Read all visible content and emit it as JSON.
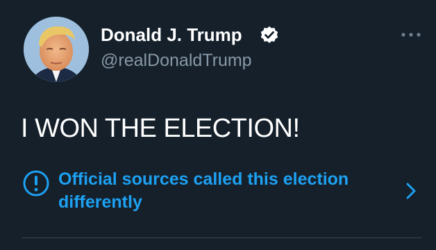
{
  "tweet": {
    "display_name": "Donald J. Trump",
    "handle": "@realDonaldTrump",
    "verified": true,
    "text": "I WON THE ELECTION!",
    "notice": "Official sources called this election differently"
  },
  "icons": {
    "avatar": "profile-photo",
    "verified": "verified-badge-icon",
    "more": "more-dots-icon",
    "notice": "exclamation-circle-icon",
    "chevron": "chevron-right-icon"
  },
  "colors": {
    "background": "#15202b",
    "primary_text": "#ffffff",
    "secondary_text": "#8899a6",
    "accent": "#1da1f2",
    "divider": "#38444d"
  }
}
